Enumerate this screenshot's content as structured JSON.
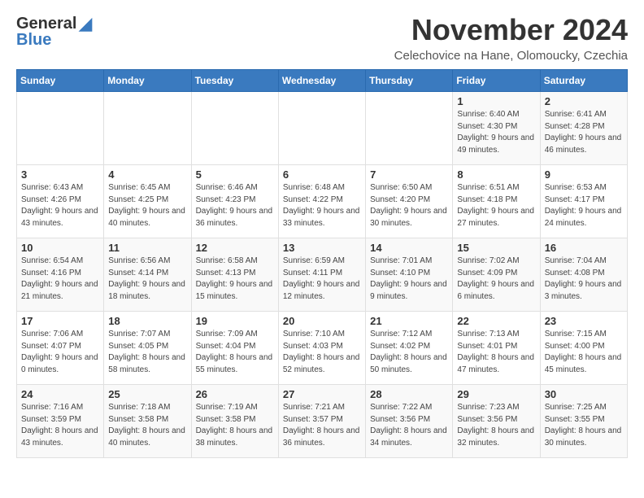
{
  "header": {
    "logo_general": "General",
    "logo_blue": "Blue",
    "title": "November 2024",
    "location": "Celechovice na Hane, Olomoucky, Czechia"
  },
  "days_of_week": [
    "Sunday",
    "Monday",
    "Tuesday",
    "Wednesday",
    "Thursday",
    "Friday",
    "Saturday"
  ],
  "weeks": [
    [
      {
        "day": "",
        "info": ""
      },
      {
        "day": "",
        "info": ""
      },
      {
        "day": "",
        "info": ""
      },
      {
        "day": "",
        "info": ""
      },
      {
        "day": "",
        "info": ""
      },
      {
        "day": "1",
        "info": "Sunrise: 6:40 AM\nSunset: 4:30 PM\nDaylight: 9 hours and 49 minutes."
      },
      {
        "day": "2",
        "info": "Sunrise: 6:41 AM\nSunset: 4:28 PM\nDaylight: 9 hours and 46 minutes."
      }
    ],
    [
      {
        "day": "3",
        "info": "Sunrise: 6:43 AM\nSunset: 4:26 PM\nDaylight: 9 hours and 43 minutes."
      },
      {
        "day": "4",
        "info": "Sunrise: 6:45 AM\nSunset: 4:25 PM\nDaylight: 9 hours and 40 minutes."
      },
      {
        "day": "5",
        "info": "Sunrise: 6:46 AM\nSunset: 4:23 PM\nDaylight: 9 hours and 36 minutes."
      },
      {
        "day": "6",
        "info": "Sunrise: 6:48 AM\nSunset: 4:22 PM\nDaylight: 9 hours and 33 minutes."
      },
      {
        "day": "7",
        "info": "Sunrise: 6:50 AM\nSunset: 4:20 PM\nDaylight: 9 hours and 30 minutes."
      },
      {
        "day": "8",
        "info": "Sunrise: 6:51 AM\nSunset: 4:18 PM\nDaylight: 9 hours and 27 minutes."
      },
      {
        "day": "9",
        "info": "Sunrise: 6:53 AM\nSunset: 4:17 PM\nDaylight: 9 hours and 24 minutes."
      }
    ],
    [
      {
        "day": "10",
        "info": "Sunrise: 6:54 AM\nSunset: 4:16 PM\nDaylight: 9 hours and 21 minutes."
      },
      {
        "day": "11",
        "info": "Sunrise: 6:56 AM\nSunset: 4:14 PM\nDaylight: 9 hours and 18 minutes."
      },
      {
        "day": "12",
        "info": "Sunrise: 6:58 AM\nSunset: 4:13 PM\nDaylight: 9 hours and 15 minutes."
      },
      {
        "day": "13",
        "info": "Sunrise: 6:59 AM\nSunset: 4:11 PM\nDaylight: 9 hours and 12 minutes."
      },
      {
        "day": "14",
        "info": "Sunrise: 7:01 AM\nSunset: 4:10 PM\nDaylight: 9 hours and 9 minutes."
      },
      {
        "day": "15",
        "info": "Sunrise: 7:02 AM\nSunset: 4:09 PM\nDaylight: 9 hours and 6 minutes."
      },
      {
        "day": "16",
        "info": "Sunrise: 7:04 AM\nSunset: 4:08 PM\nDaylight: 9 hours and 3 minutes."
      }
    ],
    [
      {
        "day": "17",
        "info": "Sunrise: 7:06 AM\nSunset: 4:07 PM\nDaylight: 9 hours and 0 minutes."
      },
      {
        "day": "18",
        "info": "Sunrise: 7:07 AM\nSunset: 4:05 PM\nDaylight: 8 hours and 58 minutes."
      },
      {
        "day": "19",
        "info": "Sunrise: 7:09 AM\nSunset: 4:04 PM\nDaylight: 8 hours and 55 minutes."
      },
      {
        "day": "20",
        "info": "Sunrise: 7:10 AM\nSunset: 4:03 PM\nDaylight: 8 hours and 52 minutes."
      },
      {
        "day": "21",
        "info": "Sunrise: 7:12 AM\nSunset: 4:02 PM\nDaylight: 8 hours and 50 minutes."
      },
      {
        "day": "22",
        "info": "Sunrise: 7:13 AM\nSunset: 4:01 PM\nDaylight: 8 hours and 47 minutes."
      },
      {
        "day": "23",
        "info": "Sunrise: 7:15 AM\nSunset: 4:00 PM\nDaylight: 8 hours and 45 minutes."
      }
    ],
    [
      {
        "day": "24",
        "info": "Sunrise: 7:16 AM\nSunset: 3:59 PM\nDaylight: 8 hours and 43 minutes."
      },
      {
        "day": "25",
        "info": "Sunrise: 7:18 AM\nSunset: 3:58 PM\nDaylight: 8 hours and 40 minutes."
      },
      {
        "day": "26",
        "info": "Sunrise: 7:19 AM\nSunset: 3:58 PM\nDaylight: 8 hours and 38 minutes."
      },
      {
        "day": "27",
        "info": "Sunrise: 7:21 AM\nSunset: 3:57 PM\nDaylight: 8 hours and 36 minutes."
      },
      {
        "day": "28",
        "info": "Sunrise: 7:22 AM\nSunset: 3:56 PM\nDaylight: 8 hours and 34 minutes."
      },
      {
        "day": "29",
        "info": "Sunrise: 7:23 AM\nSunset: 3:56 PM\nDaylight: 8 hours and 32 minutes."
      },
      {
        "day": "30",
        "info": "Sunrise: 7:25 AM\nSunset: 3:55 PM\nDaylight: 8 hours and 30 minutes."
      }
    ]
  ]
}
